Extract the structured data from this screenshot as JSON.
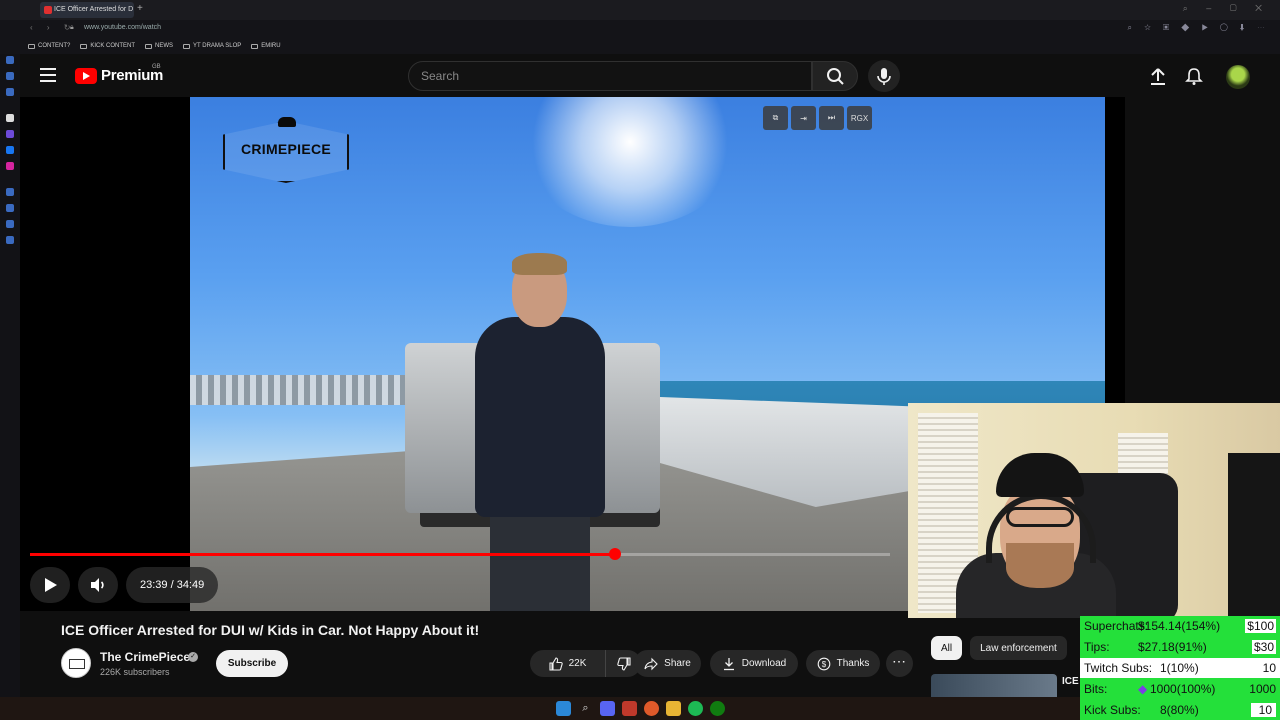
{
  "browser": {
    "tab_title": "ICE Officer Arrested for D",
    "url": "www.youtube.com/watch",
    "bookmarks": [
      "CONTENT?",
      "KICK CONTENT",
      "NEWS",
      "YT DRAMA SLOP",
      "EMIRU"
    ]
  },
  "header": {
    "logo_text": "Premium",
    "region": "GB",
    "search_placeholder": "Search"
  },
  "player": {
    "watermark": "CRIMEPIECE",
    "overlay_buttons": [
      "⧉",
      "⇥",
      "⏭",
      "RGX"
    ],
    "current_time": "23:39",
    "duration": "34:49",
    "time_display": "23:39 / 34:49",
    "progress": 0.68
  },
  "video": {
    "title": "ICE Officer Arrested for DUI w/ Kids in Car. Not Happy About it!",
    "channel_name": "The CrimePiece",
    "subscribers": "226K subscribers",
    "subscribe_label": "Subscribe",
    "like_count": "22K",
    "share_label": "Share",
    "download_label": "Download",
    "thanks_label": "Thanks"
  },
  "chips": [
    "All",
    "Law enforcement"
  ],
  "recommendation": {
    "title": "ICE"
  },
  "stream_stats": [
    {
      "label": "Superchats:",
      "value": "$154.14(154%)",
      "goal": "$100"
    },
    {
      "label": "Tips:",
      "value": "$27.18(91%)",
      "goal": "$30"
    },
    {
      "label": "Twitch Subs:",
      "value": "1(10%)",
      "goal": "10"
    },
    {
      "label": "Bits:",
      "value": "1000(100%)",
      "goal": "1000"
    },
    {
      "label": "Kick Subs:",
      "value": "8(80%)",
      "goal": "10"
    }
  ],
  "colors": {
    "accent": "#ff0000",
    "stats_bg": "#24e03a"
  }
}
